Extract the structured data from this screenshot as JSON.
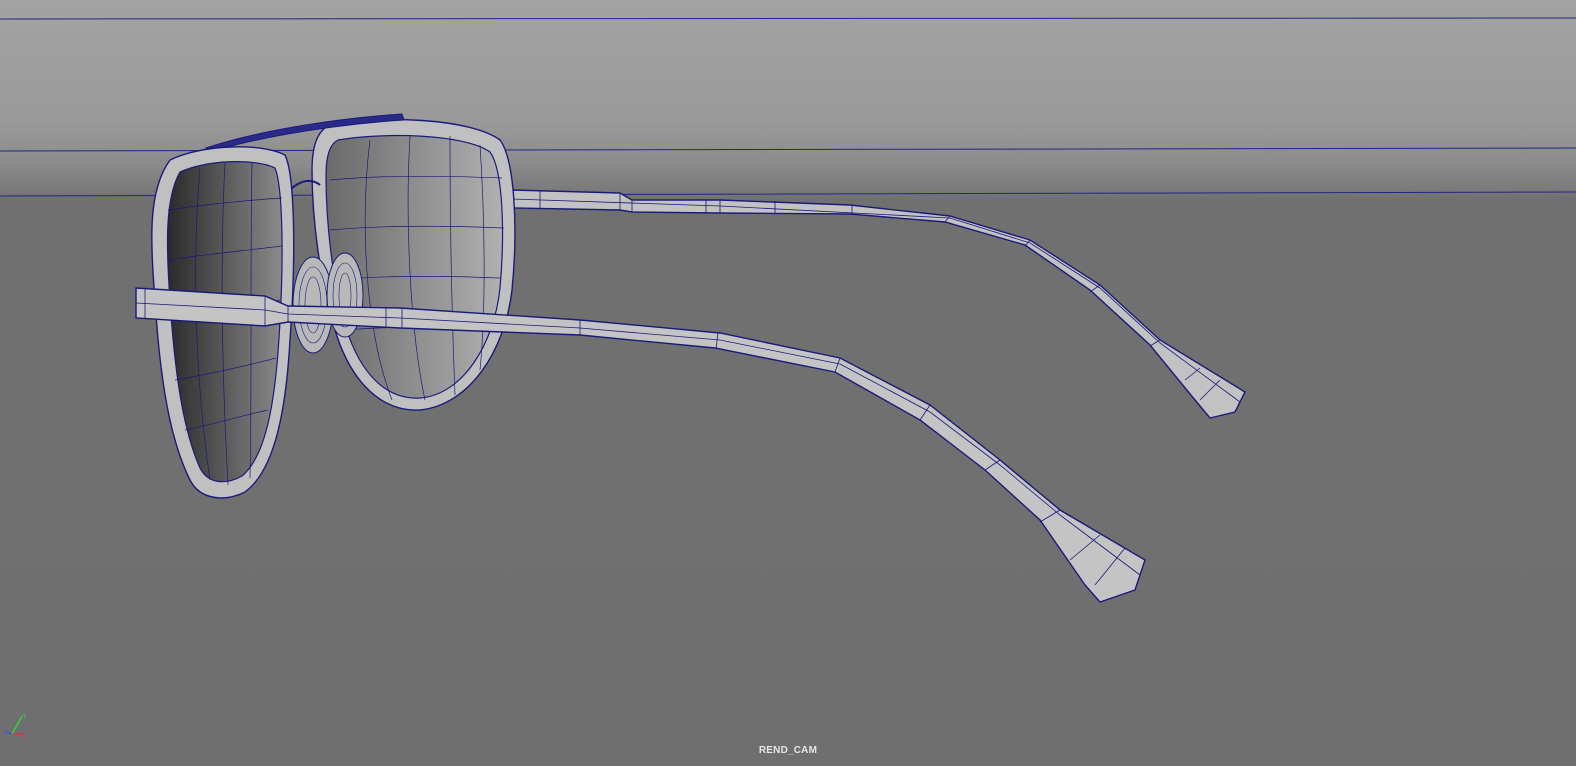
{
  "viewport": {
    "camera_name": "REND_CAM",
    "background_colors": {
      "top": "#a3a3a3",
      "bottom": "#6f6f6f"
    },
    "wireframe_color": "#1a1a7a",
    "surface_color": "#bfbfbf"
  },
  "axis_gizmo": {
    "x_label": "x",
    "y_label": "y",
    "z_label": "z",
    "colors": {
      "x": "#d23a3a",
      "y": "#3ad23a",
      "z": "#3a5ad2"
    }
  },
  "scene": {
    "object_name": "sunglasses-model",
    "display_mode": "wireframe-on-shaded"
  }
}
